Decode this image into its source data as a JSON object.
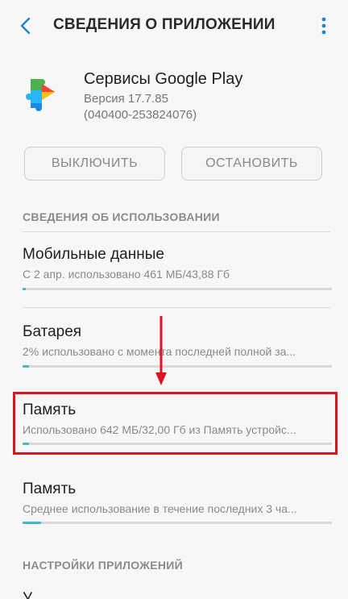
{
  "appbar": {
    "title": "СВЕДЕНИЯ О ПРИЛОЖЕНИИ",
    "back_icon": "back-arrow-icon",
    "more_icon": "more-vert-icon"
  },
  "app": {
    "name": "Сервисы Google Play",
    "version": "Версия 17.7.85",
    "build": "(040400-253824076)"
  },
  "buttons": {
    "disable_label": "ВЫКЛЮЧИТЬ",
    "stop_label": "ОСТАНОВИТЬ"
  },
  "sections": {
    "usage_header": "СВЕДЕНИЯ ОБ ИСПОЛЬЗОВАНИИ",
    "settings_header": "НАСТРОЙКИ ПРИЛОЖЕНИЙ"
  },
  "items": [
    {
      "title": "Мобильные данные",
      "subtitle": "С 2 апр. использовано 461 МБ/43,88 Гб",
      "progress": 0.01
    },
    {
      "title": "Батарея",
      "subtitle": "2% использовано с момента последней полной за...",
      "progress": 0.02
    },
    {
      "title": "Память",
      "subtitle": "Использовано 642 МБ/32,00 Гб из Память устройс...",
      "progress": 0.02
    },
    {
      "title": "Память",
      "subtitle": "Среднее использование в течение последних 3 ча...",
      "progress": 0.06
    }
  ],
  "partial_item": "У",
  "colors": {
    "accent": "#3fb8c4",
    "highlight": "#d9151f",
    "back_arrow": "#1e88c7"
  }
}
